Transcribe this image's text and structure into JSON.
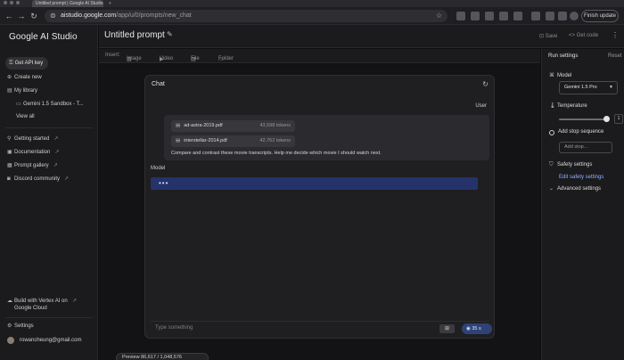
{
  "browser": {
    "tabs": [
      "Untitled prompt | Google AI Studio",
      "+"
    ],
    "url_domain": "aistudio.google.com",
    "url_path": "/app/u/0/prompts/new_chat",
    "finish_update": "Finish update"
  },
  "sidebar": {
    "brand": "Google AI Studio",
    "get_api_key": "Get API key",
    "create_new": "Create new",
    "my_library": "My library",
    "library_item": "Gemini 1.5 Sandbox - T...",
    "view_all": "View all",
    "getting_started": "Getting started",
    "documentation": "Documentation",
    "prompt_gallery": "Prompt gallery",
    "discord": "Discord community",
    "vertex": "Build with Vertex AI on Google Cloud",
    "settings": "Settings",
    "account": "rowancheung@gmail.com"
  },
  "header": {
    "title": "Untitled prompt",
    "save": "Save",
    "get_code": "Get code"
  },
  "insert_bar": {
    "label": "Insert:",
    "image": "Image",
    "video": "Video",
    "file": "File",
    "folder": "Folder"
  },
  "chat": {
    "title": "Chat",
    "user_label": "User",
    "files": [
      {
        "name": "ad-astra-2019.pdf",
        "tokens": "43,598 tokens"
      },
      {
        "name": "interstellar-2014.pdf",
        "tokens": "42,762 tokens"
      }
    ],
    "user_text": "Compare and contrast these movie transcripts. Help me decide which movie I should watch next.",
    "model_label": "Model",
    "model_typing": "•••",
    "input_placeholder": "Type something",
    "run_label": "35 s",
    "preview": "Preview  86,617 / 1,048,576"
  },
  "settings": {
    "title": "Run settings",
    "reset": "Reset",
    "model_label": "Model",
    "model_value": "Gemini 1.5 Pro",
    "temperature_label": "Temperature",
    "temperature_value": "1",
    "temperature_level": 1.0,
    "stop_label": "Add stop sequence",
    "stop_placeholder": "Add stop...",
    "safety_label": "Safety settings",
    "edit_safety": "Edit safety settings",
    "advanced": "Advanced settings"
  },
  "colors": {
    "accent_blue": "#25336a",
    "link_blue": "#8fb1ff",
    "background": "#0e0e10"
  }
}
